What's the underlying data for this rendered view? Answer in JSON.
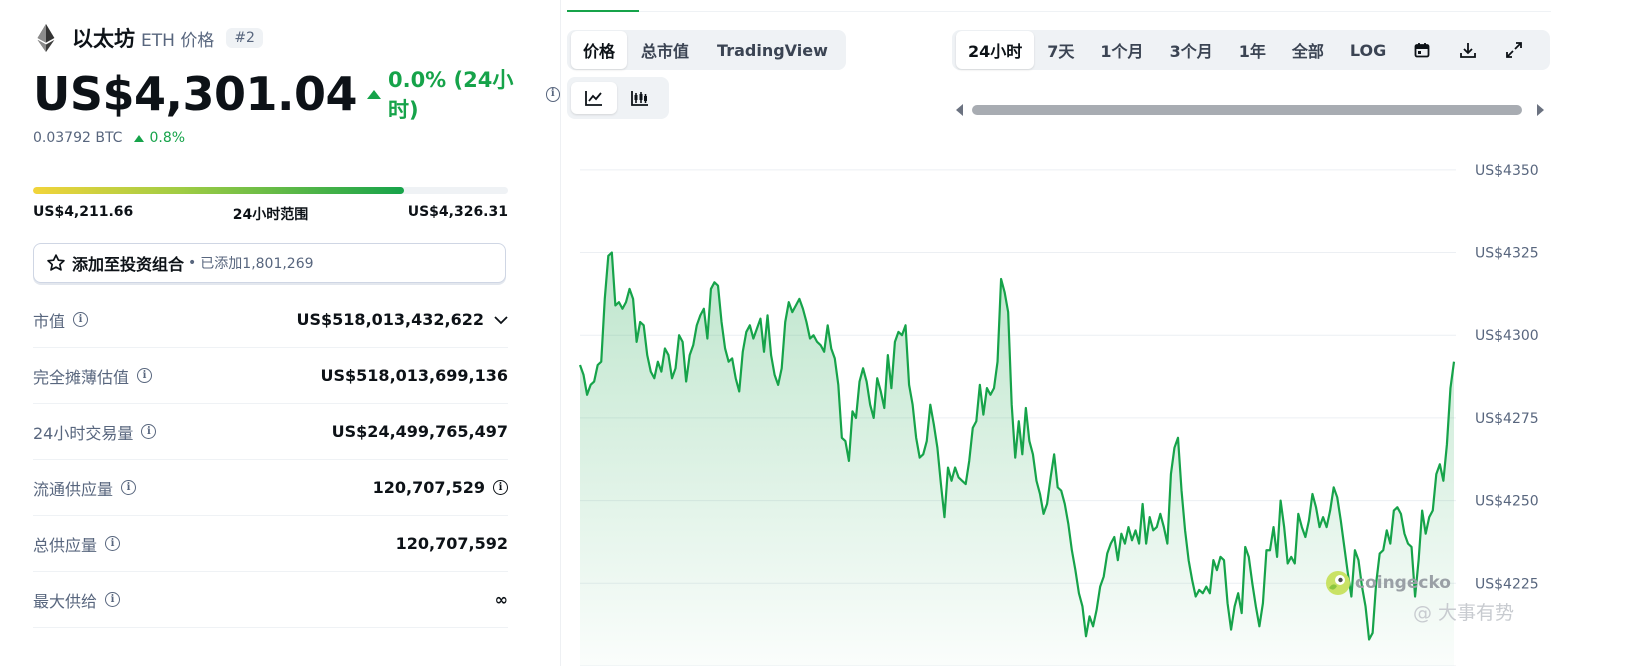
{
  "coin": {
    "name": "以太坊",
    "symbol_label": "ETH 价格",
    "rank": "#2",
    "price": "US$4,301.04",
    "change": "0.0% (24小时)",
    "btc_price": "0.03792 BTC",
    "btc_change": "0.8%"
  },
  "range_24h": {
    "low": "US$4,211.66",
    "label": "24小时范围",
    "high": "US$4,326.31",
    "position": 0.78
  },
  "portfolio": {
    "label": "添加至投资组合",
    "separator": "•",
    "added": "已添加1,801,269"
  },
  "stats": [
    {
      "label": "市值",
      "value": "US$518,013,432,622"
    },
    {
      "label": "完全摊薄估值",
      "value": "US$518,013,699,136"
    },
    {
      "label": "24小时交易量",
      "value": "US$24,499,765,497"
    },
    {
      "label": "流通供应量",
      "value": "120,707,529"
    },
    {
      "label": "总供应量",
      "value": "120,707,592"
    },
    {
      "label": "最大供给",
      "value": "∞"
    }
  ],
  "chart_tabs": [
    "价格",
    "总市值",
    "TradingView"
  ],
  "time_ranges": [
    "24小时",
    "7天",
    "1个月",
    "3个月",
    "1年",
    "全部",
    "LOG"
  ],
  "icons": {
    "coin": "ethereum-icon",
    "info": "info-icon",
    "star": "star-icon",
    "chevron": "chevron-down-icon",
    "line_chart": "line-chart-icon",
    "candle_chart": "candlestick-chart-icon",
    "calendar": "calendar-icon",
    "download": "download-icon",
    "expand": "expand-icon"
  },
  "colors": {
    "positive": "#16a34a",
    "text_muted": "#58667e",
    "chart_line": "#16a34a"
  },
  "branding": {
    "coingecko": "coingecko",
    "watermark": "@ 大事有势"
  },
  "chart_data": {
    "type": "area",
    "title": "",
    "xlabel": "",
    "ylabel": "",
    "ylim": [
      4200,
      4356
    ],
    "y_ticks": [
      4350,
      4325,
      4300,
      4275,
      4250,
      4225
    ],
    "y_tick_labels": [
      "US$4350",
      "US$4325",
      "US$4300",
      "US$4275",
      "US$4250",
      "US$4225"
    ],
    "grid": true,
    "series": [
      {
        "values": [
          4291,
          4288,
          4282,
          4285,
          4286,
          4291,
          4292,
          4311,
          4324,
          4325,
          4309,
          4310,
          4308,
          4310,
          4314,
          4311,
          4298,
          4304,
          4303,
          4294,
          4289,
          4287,
          4292,
          4289,
          4296,
          4294,
          4287,
          4290,
          4300,
          4298,
          4286,
          4294,
          4297,
          4303,
          4306,
          4308,
          4299,
          4314,
          4316,
          4315,
          4304,
          4296,
          4292,
          4293,
          4287,
          4283,
          4295,
          4301,
          4303,
          4299,
          4302,
          4305,
          4295,
          4306,
          4294,
          4288,
          4285,
          4290,
          4304,
          4310,
          4307,
          4309,
          4311,
          4308,
          4304,
          4299,
          4300,
          4298,
          4297,
          4295,
          4303,
          4296,
          4293,
          4285,
          4269,
          4268,
          4262,
          4277,
          4275,
          4286,
          4290,
          4286,
          4279,
          4275,
          4287,
          4283,
          4278,
          4294,
          4284,
          4298,
          4301,
          4300,
          4303,
          4285,
          4279,
          4269,
          4263,
          4264,
          4268,
          4279,
          4273,
          4266,
          4255,
          4245,
          4260,
          4256,
          4260,
          4257,
          4256,
          4255,
          4262,
          4272,
          4274,
          4285,
          4276,
          4284,
          4282,
          4284,
          4292,
          4317,
          4313,
          4307,
          4279,
          4263,
          4274,
          4264,
          4278,
          4268,
          4264,
          4256,
          4252,
          4246,
          4249,
          4257,
          4264,
          4254,
          4253,
          4249,
          4243,
          4235,
          4229,
          4222,
          4218,
          4209,
          4215,
          4212,
          4217,
          4224,
          4227,
          4234,
          4237,
          4239,
          4232,
          4240,
          4237,
          4242,
          4238,
          4241,
          4237,
          4249,
          4237,
          4245,
          4241,
          4242,
          4246,
          4242,
          4237,
          4258,
          4266,
          4269,
          4253,
          4241,
          4232,
          4226,
          4221,
          4223,
          4222,
          4224,
          4222,
          4232,
          4229,
          4233,
          4232,
          4219,
          4211,
          4218,
          4222,
          4216,
          4236,
          4233,
          4225,
          4218,
          4212,
          4219,
          4235,
          4235,
          4242,
          4233,
          4250,
          4242,
          4231,
          4233,
          4231,
          4246,
          4242,
          4239,
          4244,
          4252,
          4248,
          4242,
          4245,
          4242,
          4247,
          4254,
          4251,
          4244,
          4236,
          4228,
          4221,
          4235,
          4232,
          4224,
          4218,
          4208,
          4210,
          4225,
          4234,
          4235,
          4241,
          4237,
          4247,
          4248,
          4246,
          4240,
          4237,
          4236,
          4221,
          4232,
          4247,
          4240,
          4245,
          4247,
          4258,
          4261,
          4256,
          4267,
          4284,
          4292
        ]
      }
    ]
  }
}
